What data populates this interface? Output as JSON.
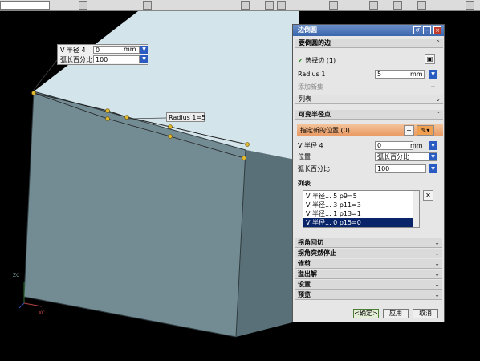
{
  "dialog": {
    "title": "边倒圆",
    "sections": {
      "edge": "要倒圆的边",
      "variable": "可变半径点",
      "corner_setback": "拐角回切",
      "corner_stop": "拐角突然停止",
      "trim": "修剪",
      "overflow": "溢出解",
      "settings": "设置",
      "preview": "预览"
    },
    "select_edge": "选择边 (1)",
    "radius_label": "Radius 1",
    "radius_value": "5",
    "radius_unit": "mm",
    "add_new_set": "添加新集",
    "list_label": "列表",
    "specify_location": "指定新的位置 (0)",
    "v_radius_label": "V 半径 4",
    "v_radius_value": "0",
    "v_radius_unit": "mm",
    "position_label": "位置",
    "position_value": "弧长百分比",
    "arc_pct_label": "弧长百分比",
    "arc_pct_value": "100",
    "list2_label": "列表",
    "list_items": [
      "V 半径... 5  p9=5",
      "V 半径... 3  p11=3",
      "V 半径... 1  p13=1",
      "V 半径... 0  p15=0"
    ],
    "ok": "<确定>",
    "apply": "应用",
    "cancel": "取消"
  },
  "screen_input": {
    "row1_label": "V 半径 4",
    "row1_value": "0",
    "row1_unit": "mm",
    "row2_label": "弧长百分比",
    "row2_value": "100"
  },
  "tag": "Radius 1=5",
  "axes": {
    "zc": "ZC",
    "xc": "XC"
  },
  "icons": [
    "check-icon",
    "cube-icon",
    "point-icon",
    "edit-icon",
    "close-icon",
    "refresh-icon",
    "minimize-icon",
    "chevron-up-icon",
    "chevron-down-icon"
  ]
}
